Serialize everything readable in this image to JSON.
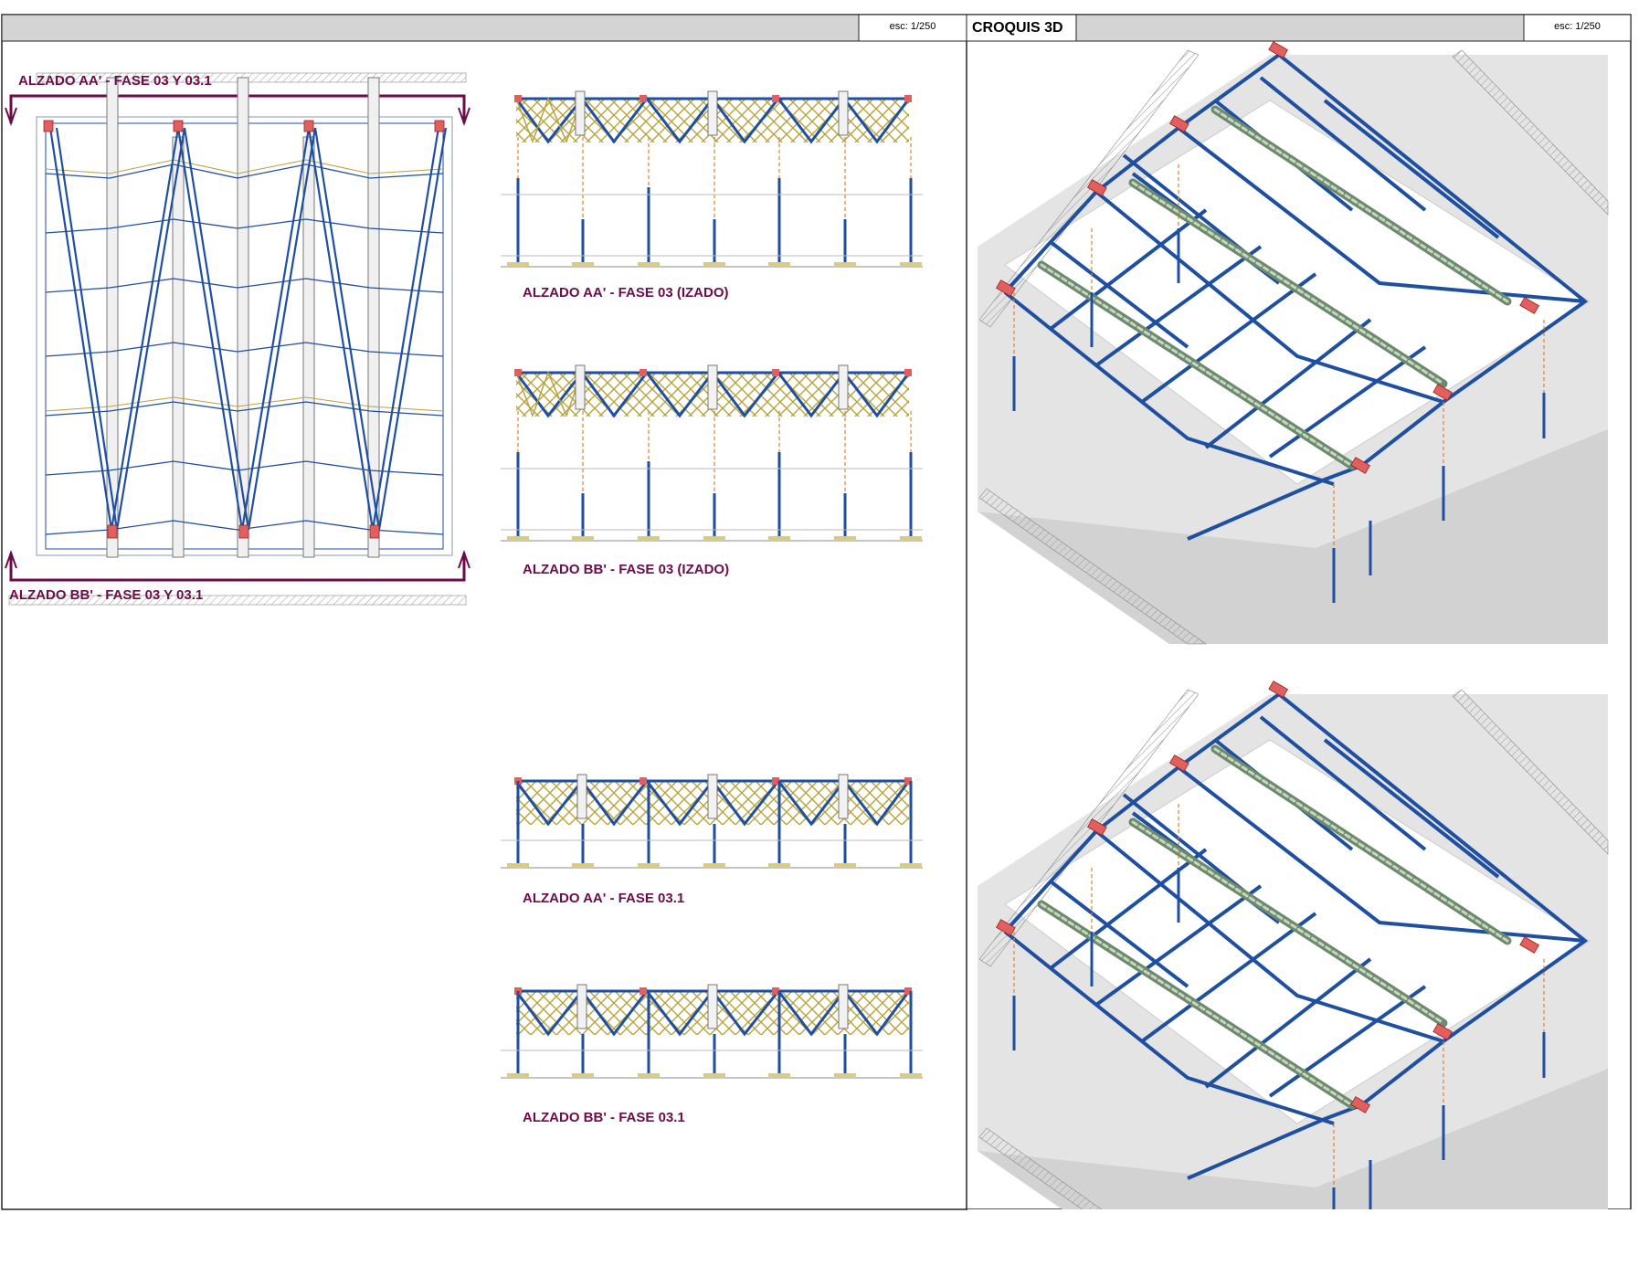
{
  "header": {
    "left_scale": "esc: 1/250",
    "right_title": "CROQUIS 3D",
    "right_scale": "esc: 1/250"
  },
  "plan": {
    "top_label": "ALZADO AA' - FASE 03 Y 03.1",
    "bottom_label": "ALZADO BB' - FASE 03 Y 03.1"
  },
  "elevations": [
    {
      "label": "ALZADO AA' - FASE 03 (IZADO)"
    },
    {
      "label": "ALZADO BB' - FASE 03 (IZADO)"
    },
    {
      "label": "ALZADO AA' - FASE 03.1"
    },
    {
      "label": "ALZADO BB' - FASE 03.1"
    }
  ],
  "colors": {
    "frame_blue": "#1f4fa0",
    "truss_yellow": "#b9a23a",
    "bearing_red": "#e06060",
    "cable_orange": "#e08030",
    "label_purple": "#6b0d4a",
    "beam_green": "#8aa080",
    "ground_gray": "#dcdcdc"
  }
}
